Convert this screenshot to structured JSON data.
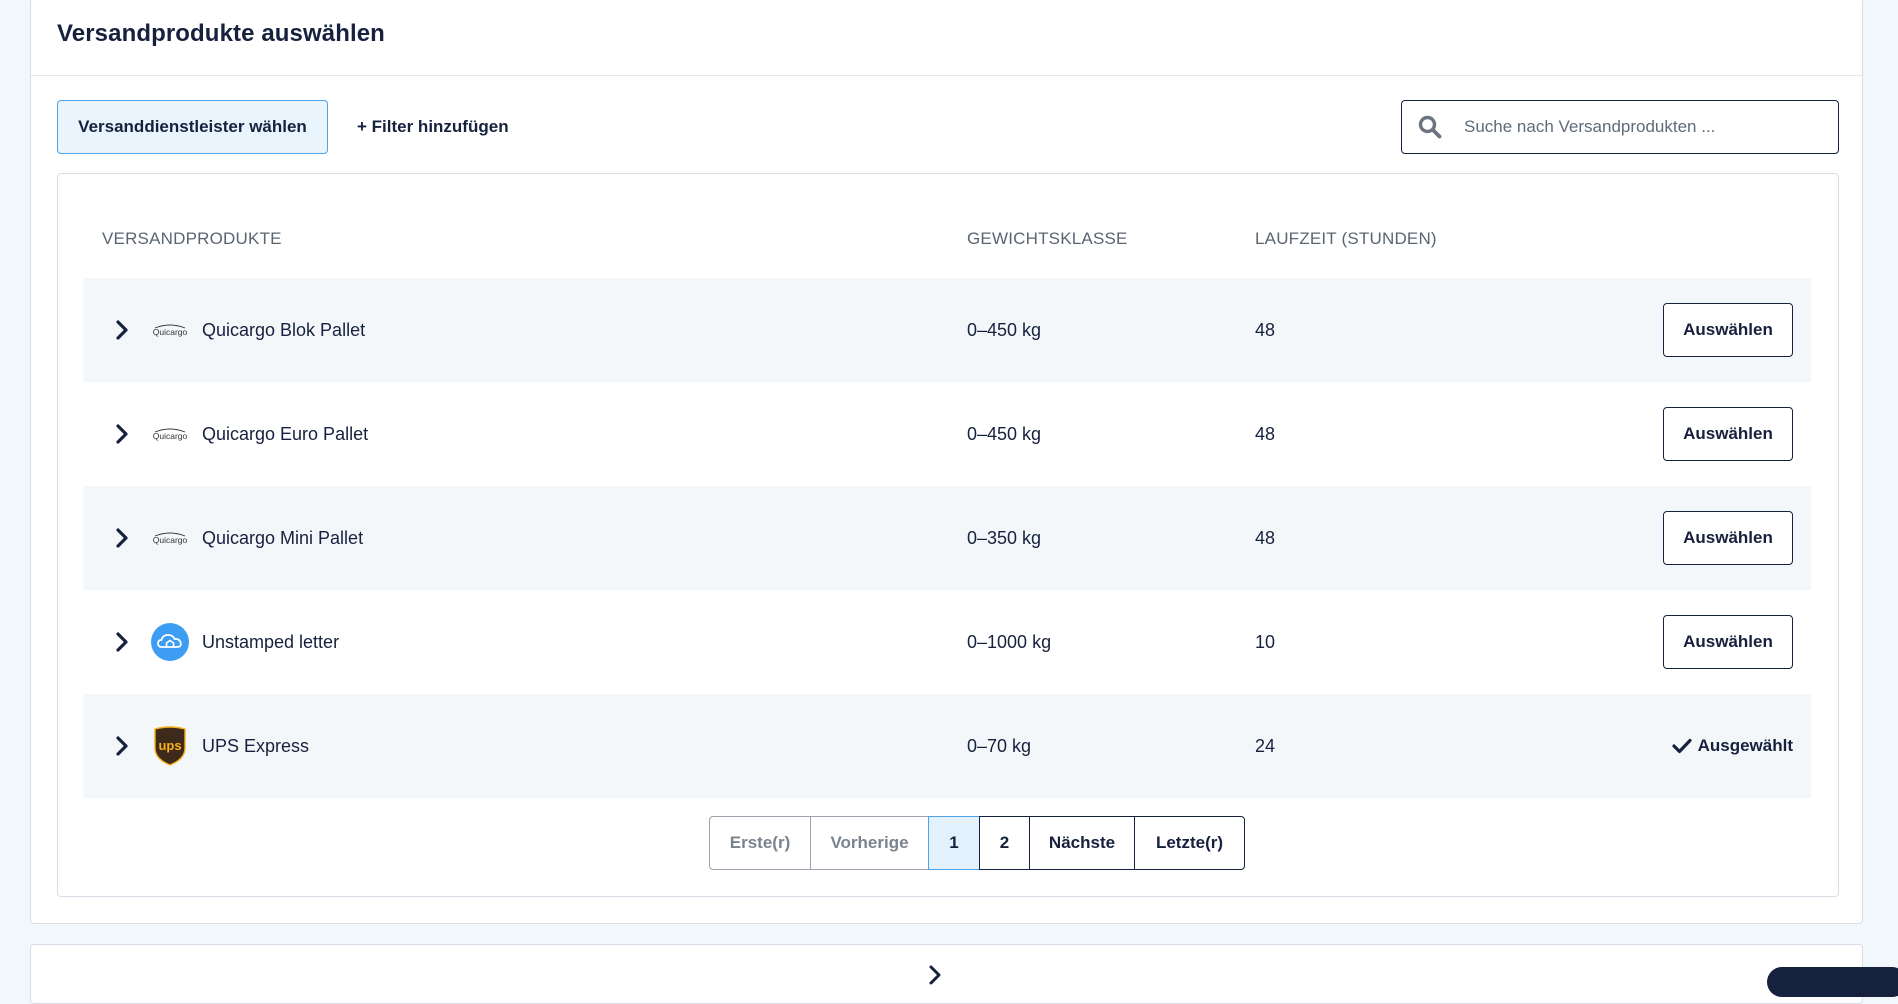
{
  "card": {
    "title": "Versandprodukte auswählen"
  },
  "toolbar": {
    "provider_button": "Versanddienstleister wählen",
    "filter_button": "+ Filter hinzufügen",
    "search_placeholder": "Suche nach Versandprodukten ..."
  },
  "table": {
    "headers": {
      "product": "VERSANDPRODUKTE",
      "weight": "GEWICHTSKLASSE",
      "time": "LAUFZEIT (STUNDEN)"
    },
    "rows": [
      {
        "logo": "quicargo",
        "logo_text": "Quicargo",
        "name": "Quicargo Blok Pallet",
        "weight": "0–450 kg",
        "time": "48",
        "action": "Auswählen"
      },
      {
        "logo": "quicargo",
        "logo_text": "Quicargo",
        "name": "Quicargo Euro Pallet",
        "weight": "0–450 kg",
        "time": "48",
        "action": "Auswählen"
      },
      {
        "logo": "quicargo",
        "logo_text": "Quicargo",
        "name": "Quicargo Mini Pallet",
        "weight": "0–350 kg",
        "time": "48",
        "action": "Auswählen"
      },
      {
        "logo": "cloud-home",
        "name": "Unstamped letter",
        "weight": "0–1000 kg",
        "time": "10",
        "action": "Auswählen"
      },
      {
        "logo": "ups",
        "logo_text": "ups",
        "name": "UPS Express",
        "weight": "0–70 kg",
        "time": "24",
        "action_selected": "Ausgewählt"
      }
    ]
  },
  "pagination": {
    "first": "Erste(r)",
    "prev": "Vorherige",
    "pages": [
      "1",
      "2"
    ],
    "current": "1",
    "next": "Nächste",
    "last": "Letzte(r)"
  },
  "colors": {
    "primary": "#16213e",
    "accent": "#4da3e6",
    "accent_bg": "#e9f4fd",
    "row_shade": "#f4f7fa",
    "page_bg": "#f2f7fb",
    "ups_brown": "#3d2a1a",
    "ups_gold": "#f5b21b",
    "cloud_blue": "#3d9df2"
  }
}
